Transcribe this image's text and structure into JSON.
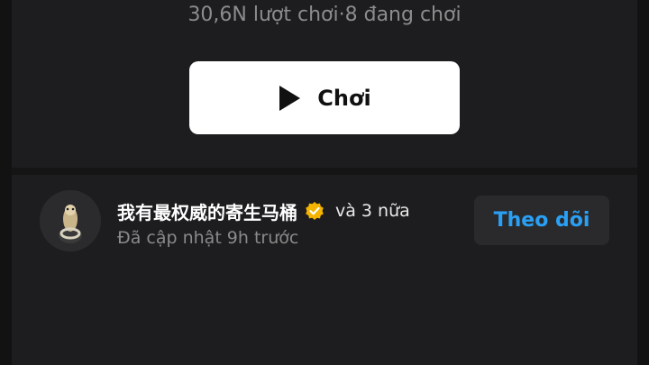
{
  "game": {
    "stats": "30,6N lượt chơi·8 đang chơi"
  },
  "play_button": {
    "icon": "play-icon",
    "label": "Chơi"
  },
  "creator": {
    "name": "我有最权威的寄生马桶",
    "verified_icon": "verified-badge-icon",
    "more": "và 3 nữa",
    "updated": "Đã cập nhật 9h trước",
    "follow_label": "Theo dõi"
  },
  "colors": {
    "background": "#1d1d1f",
    "accent": "#2aa0f5",
    "badge": "#f4b400"
  }
}
